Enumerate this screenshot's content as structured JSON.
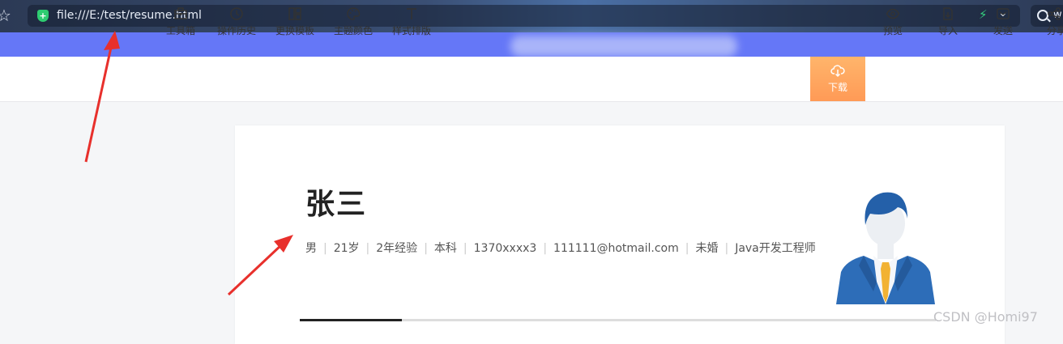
{
  "browser": {
    "url": "file:///E:/test/resume.html",
    "search_text": "w"
  },
  "toolbar": {
    "items": [
      {
        "label": "工具箱",
        "icon": "toolbox-icon"
      },
      {
        "label": "操作历史",
        "icon": "history-icon"
      },
      {
        "label": "更换模板",
        "icon": "template-icon"
      },
      {
        "label": "主题颜色",
        "icon": "palette-icon"
      },
      {
        "label": "样式排版",
        "icon": "text-style-icon"
      }
    ],
    "right_items": [
      {
        "label": "下载",
        "icon": "cloud-download-icon"
      },
      {
        "label": "预览",
        "icon": "eye-icon"
      },
      {
        "label": "导入",
        "icon": "import-icon"
      },
      {
        "label": "发送",
        "icon": "mail-icon"
      },
      {
        "label": "分享",
        "icon": "share-icon"
      }
    ],
    "accent_color": "#ff9a56"
  },
  "resume": {
    "name": "张三",
    "info": [
      "男",
      "21岁",
      "2年经验",
      "本科",
      "1370xxxx3",
      "111111@hotmail.com",
      "未婚",
      "Java开发工程师"
    ],
    "section_progress": 0.16
  },
  "colors": {
    "banner": "#6577f7",
    "annotation_arrow": "#e8302c"
  },
  "watermark": "CSDN @Homi97"
}
